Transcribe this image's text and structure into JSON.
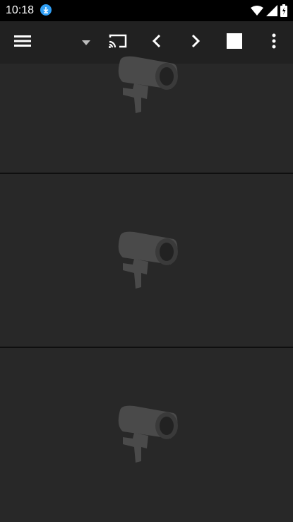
{
  "status_bar": {
    "time": "10:18",
    "icons": [
      "download-icon",
      "wifi-icon",
      "cellular-signal-icon",
      "battery-icon"
    ]
  },
  "toolbar": {
    "icons": [
      "menu-icon",
      "dropdown-arrow-icon",
      "cast-icon",
      "chevron-left-icon",
      "chevron-right-icon",
      "stop-icon",
      "more-vert-icon"
    ]
  },
  "cameras": [
    {
      "icon": "cctv-camera-icon"
    },
    {
      "icon": "cctv-camera-icon"
    },
    {
      "icon": "cctv-camera-icon"
    }
  ],
  "colors": {
    "background": "#2b2b2b",
    "toolbar": "#212121",
    "status_bar": "#000000",
    "download_badge": "#2f9ef4",
    "icon": "#ffffff"
  }
}
